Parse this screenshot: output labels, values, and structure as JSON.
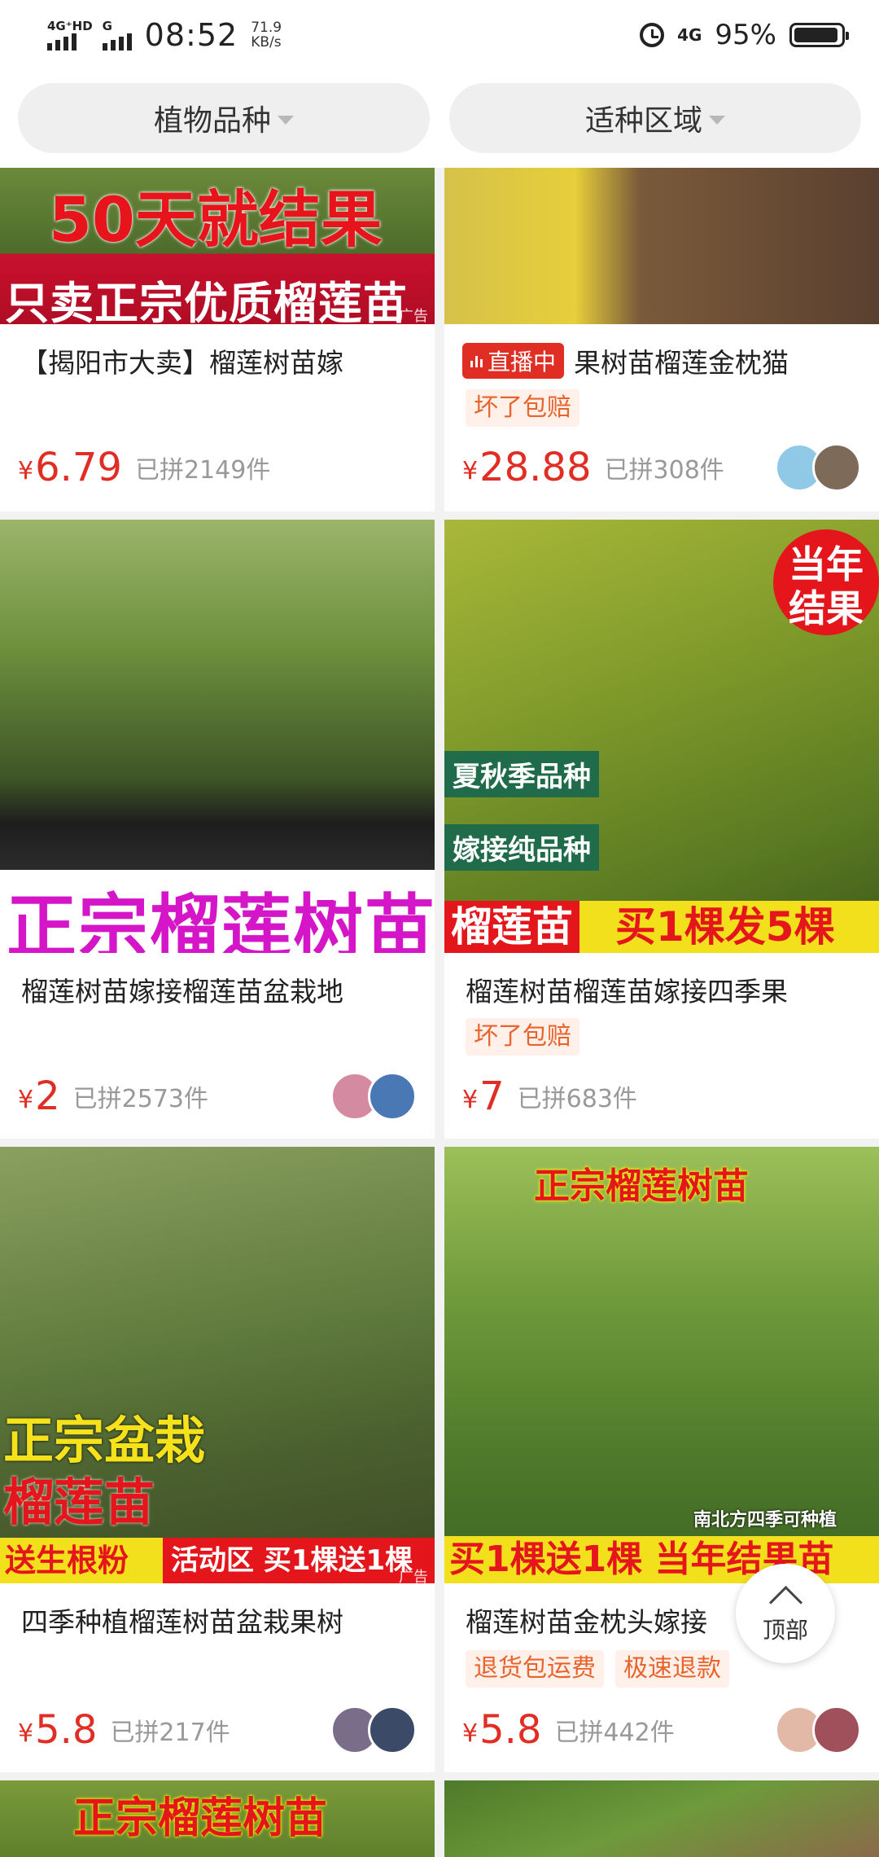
{
  "status_bar": {
    "sig1_label": "4G⁺HD",
    "sig2_label": "G",
    "time": "08:52",
    "speed_value": "71.9",
    "speed_unit": "KB/s",
    "net_label": "4G",
    "battery_pct": "95%",
    "battery_level": 0.95
  },
  "filters": {
    "left_label": "植物品种",
    "right_label": "适种区域"
  },
  "products": [
    {
      "title": "【揭阳市大卖】榴莲树苗嫁",
      "price_symbol": "¥",
      "price": "6.79",
      "sold": "已拼2149件",
      "ad_label": "广告",
      "banner_top": "50天就结果",
      "banner_bottom": "只卖正宗优质榴莲苗",
      "image_icon": "durian-seedling-photo"
    },
    {
      "live_label": "直播中",
      "title": "果树苗榴莲金枕猫",
      "tags": [
        "坏了包赔"
      ],
      "price_symbol": "¥",
      "price": "28.88",
      "sold": "已拼308件",
      "image_icon": "durian-fruit-pots-photo"
    },
    {
      "title": "榴莲树苗嫁接榴莲苗盆栽地",
      "price_symbol": "¥",
      "price": "2",
      "sold": "已拼2573件",
      "banner_bottom": "正宗榴莲树苗",
      "image_icon": "potted-seedlings-row-photo"
    },
    {
      "title": "榴莲树苗榴莲苗嫁接四季果",
      "tags": [
        "坏了包赔"
      ],
      "price_symbol": "¥",
      "price": "7",
      "sold": "已拼683件",
      "badge": "当年结果",
      "label1": "夏秋季品种",
      "label2": "嫁接纯品种",
      "banner_left": "榴莲苗",
      "banner_right": "买1棵发5棵",
      "image_icon": "durian-on-tree-photo"
    },
    {
      "title": "四季种植榴莲树苗盆栽果树",
      "price_symbol": "¥",
      "price": "5.8",
      "sold": "已拼217件",
      "ad_label": "广告",
      "overlay1": "正宗盆栽",
      "overlay2": "榴莲苗",
      "banner_left": "送生根粉",
      "banner_right": "活动区 买1棵送1棵",
      "image_icon": "man-with-durian-photo"
    },
    {
      "title": "榴莲树苗金枕头嫁接",
      "title_tail": "苗",
      "tags": [
        "退货包运费",
        "极速退款"
      ],
      "price_symbol": "¥",
      "price": "5.8",
      "sold": "已拼442件",
      "banner_top": "正宗榴莲树苗",
      "small_text": "南北方四季可种植",
      "banner_bottom": "买1棵送1棵 当年结果苗",
      "image_icon": "woman-holding-durian-photo"
    },
    {
      "banner_top": "正宗榴莲树苗",
      "image_icon": "durian-tree-photo"
    },
    {
      "image_icon": "durian-leaves-photo"
    }
  ],
  "top_button": {
    "label": "顶部"
  }
}
